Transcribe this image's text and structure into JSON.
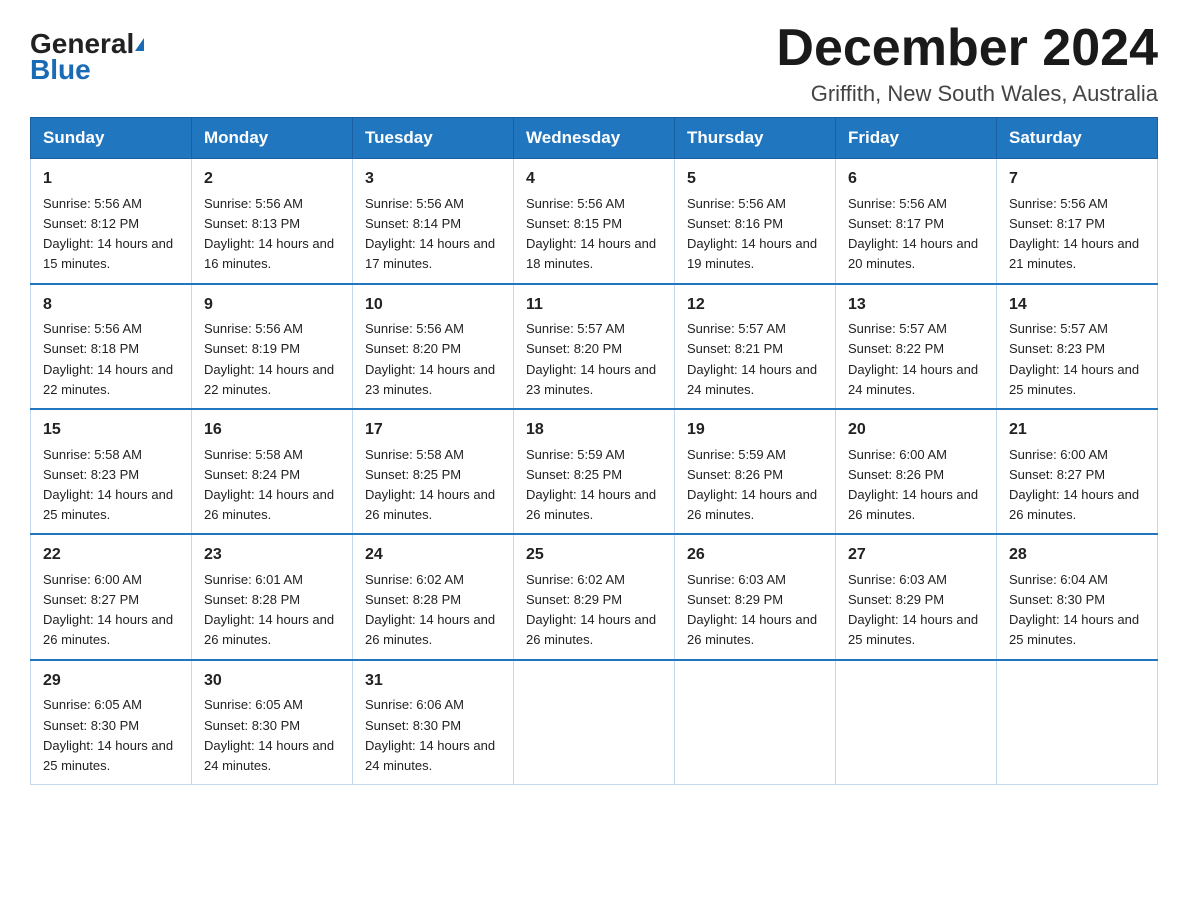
{
  "logo": {
    "text_general": "General",
    "triangle": "▶",
    "text_blue": "Blue"
  },
  "title": "December 2024",
  "location": "Griffith, New South Wales, Australia",
  "days_of_week": [
    "Sunday",
    "Monday",
    "Tuesday",
    "Wednesday",
    "Thursday",
    "Friday",
    "Saturday"
  ],
  "weeks": [
    [
      {
        "day": 1,
        "sunrise": "5:56 AM",
        "sunset": "8:12 PM",
        "daylight": "14 hours and 15 minutes."
      },
      {
        "day": 2,
        "sunrise": "5:56 AM",
        "sunset": "8:13 PM",
        "daylight": "14 hours and 16 minutes."
      },
      {
        "day": 3,
        "sunrise": "5:56 AM",
        "sunset": "8:14 PM",
        "daylight": "14 hours and 17 minutes."
      },
      {
        "day": 4,
        "sunrise": "5:56 AM",
        "sunset": "8:15 PM",
        "daylight": "14 hours and 18 minutes."
      },
      {
        "day": 5,
        "sunrise": "5:56 AM",
        "sunset": "8:16 PM",
        "daylight": "14 hours and 19 minutes."
      },
      {
        "day": 6,
        "sunrise": "5:56 AM",
        "sunset": "8:17 PM",
        "daylight": "14 hours and 20 minutes."
      },
      {
        "day": 7,
        "sunrise": "5:56 AM",
        "sunset": "8:17 PM",
        "daylight": "14 hours and 21 minutes."
      }
    ],
    [
      {
        "day": 8,
        "sunrise": "5:56 AM",
        "sunset": "8:18 PM",
        "daylight": "14 hours and 22 minutes."
      },
      {
        "day": 9,
        "sunrise": "5:56 AM",
        "sunset": "8:19 PM",
        "daylight": "14 hours and 22 minutes."
      },
      {
        "day": 10,
        "sunrise": "5:56 AM",
        "sunset": "8:20 PM",
        "daylight": "14 hours and 23 minutes."
      },
      {
        "day": 11,
        "sunrise": "5:57 AM",
        "sunset": "8:20 PM",
        "daylight": "14 hours and 23 minutes."
      },
      {
        "day": 12,
        "sunrise": "5:57 AM",
        "sunset": "8:21 PM",
        "daylight": "14 hours and 24 minutes."
      },
      {
        "day": 13,
        "sunrise": "5:57 AM",
        "sunset": "8:22 PM",
        "daylight": "14 hours and 24 minutes."
      },
      {
        "day": 14,
        "sunrise": "5:57 AM",
        "sunset": "8:23 PM",
        "daylight": "14 hours and 25 minutes."
      }
    ],
    [
      {
        "day": 15,
        "sunrise": "5:58 AM",
        "sunset": "8:23 PM",
        "daylight": "14 hours and 25 minutes."
      },
      {
        "day": 16,
        "sunrise": "5:58 AM",
        "sunset": "8:24 PM",
        "daylight": "14 hours and 26 minutes."
      },
      {
        "day": 17,
        "sunrise": "5:58 AM",
        "sunset": "8:25 PM",
        "daylight": "14 hours and 26 minutes."
      },
      {
        "day": 18,
        "sunrise": "5:59 AM",
        "sunset": "8:25 PM",
        "daylight": "14 hours and 26 minutes."
      },
      {
        "day": 19,
        "sunrise": "5:59 AM",
        "sunset": "8:26 PM",
        "daylight": "14 hours and 26 minutes."
      },
      {
        "day": 20,
        "sunrise": "6:00 AM",
        "sunset": "8:26 PM",
        "daylight": "14 hours and 26 minutes."
      },
      {
        "day": 21,
        "sunrise": "6:00 AM",
        "sunset": "8:27 PM",
        "daylight": "14 hours and 26 minutes."
      }
    ],
    [
      {
        "day": 22,
        "sunrise": "6:00 AM",
        "sunset": "8:27 PM",
        "daylight": "14 hours and 26 minutes."
      },
      {
        "day": 23,
        "sunrise": "6:01 AM",
        "sunset": "8:28 PM",
        "daylight": "14 hours and 26 minutes."
      },
      {
        "day": 24,
        "sunrise": "6:02 AM",
        "sunset": "8:28 PM",
        "daylight": "14 hours and 26 minutes."
      },
      {
        "day": 25,
        "sunrise": "6:02 AM",
        "sunset": "8:29 PM",
        "daylight": "14 hours and 26 minutes."
      },
      {
        "day": 26,
        "sunrise": "6:03 AM",
        "sunset": "8:29 PM",
        "daylight": "14 hours and 26 minutes."
      },
      {
        "day": 27,
        "sunrise": "6:03 AM",
        "sunset": "8:29 PM",
        "daylight": "14 hours and 25 minutes."
      },
      {
        "day": 28,
        "sunrise": "6:04 AM",
        "sunset": "8:30 PM",
        "daylight": "14 hours and 25 minutes."
      }
    ],
    [
      {
        "day": 29,
        "sunrise": "6:05 AM",
        "sunset": "8:30 PM",
        "daylight": "14 hours and 25 minutes."
      },
      {
        "day": 30,
        "sunrise": "6:05 AM",
        "sunset": "8:30 PM",
        "daylight": "14 hours and 24 minutes."
      },
      {
        "day": 31,
        "sunrise": "6:06 AM",
        "sunset": "8:30 PM",
        "daylight": "14 hours and 24 minutes."
      },
      null,
      null,
      null,
      null
    ]
  ]
}
